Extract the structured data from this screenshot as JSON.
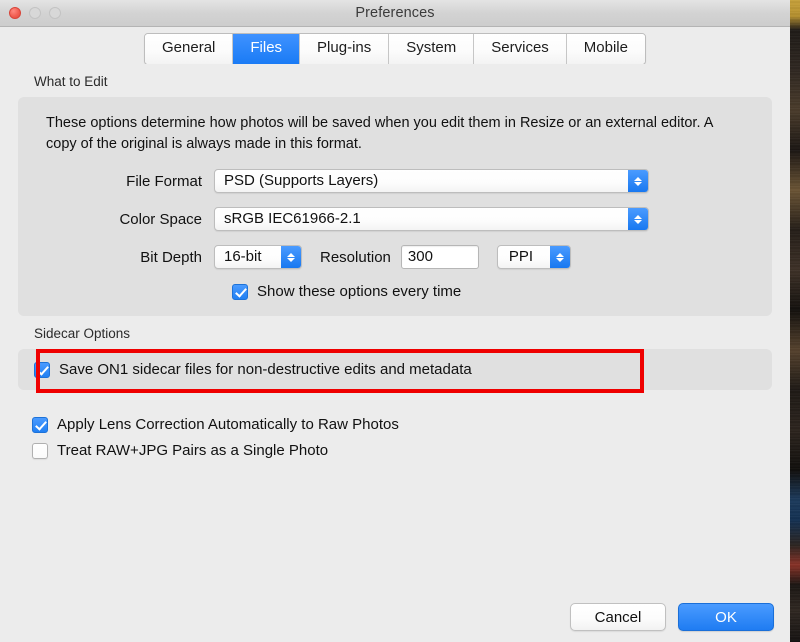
{
  "window": {
    "title": "Preferences",
    "traffic_lights": [
      "close",
      "minimize",
      "maximize"
    ]
  },
  "tabs": [
    {
      "label": "General",
      "active": false
    },
    {
      "label": "Files",
      "active": true
    },
    {
      "label": "Plug-ins",
      "active": false
    },
    {
      "label": "System",
      "active": false
    },
    {
      "label": "Services",
      "active": false
    },
    {
      "label": "Mobile",
      "active": false
    }
  ],
  "what_to_edit": {
    "section_label": "What to Edit",
    "description": "These options determine how photos will be saved when you edit them in Resize or an external editor.  A copy of the original is always made in this format.",
    "file_format": {
      "label": "File Format",
      "value": "PSD (Supports Layers)"
    },
    "color_space": {
      "label": "Color Space",
      "value": "sRGB IEC61966-2.1"
    },
    "bit_depth": {
      "label": "Bit Depth",
      "value": "16-bit"
    },
    "resolution": {
      "label": "Resolution",
      "value": "300",
      "units": "PPI"
    },
    "show_options": {
      "label": "Show these options every time",
      "checked": true
    }
  },
  "sidecar": {
    "section_label": "Sidecar Options",
    "save_sidecar": {
      "label": "Save ON1 sidecar files for non-destructive edits and metadata",
      "checked": true
    },
    "highlight_color": "#ef0000"
  },
  "bottom_options": [
    {
      "label": "Apply Lens Correction Automatically to Raw Photos",
      "checked": true
    },
    {
      "label": "Treat RAW+JPG Pairs as a Single Photo",
      "checked": false
    }
  ],
  "footer": {
    "cancel_label": "Cancel",
    "ok_label": "OK"
  },
  "colors": {
    "accent": "#1f7cf2",
    "window_bg": "#ececec",
    "group_bg": "#e0e0e0",
    "highlight": "#ef0000"
  }
}
